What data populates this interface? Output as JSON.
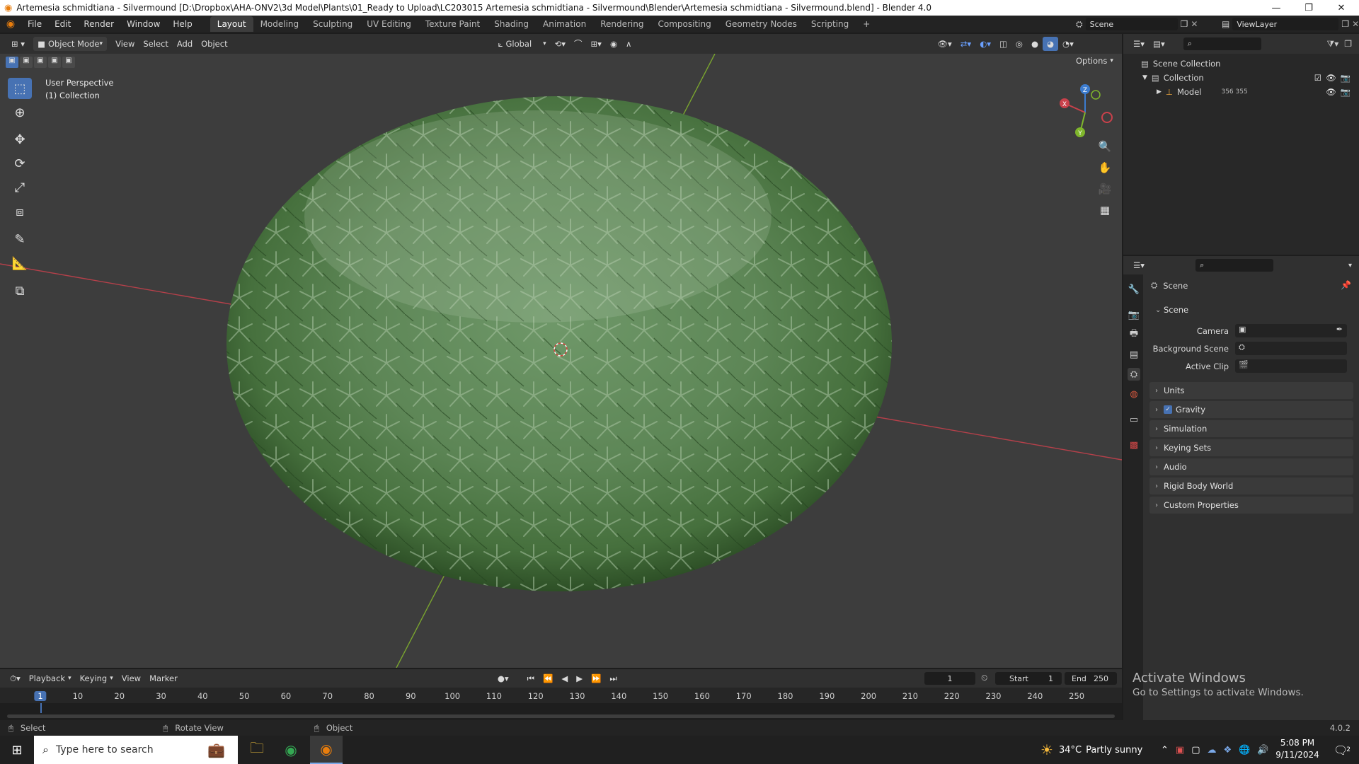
{
  "window": {
    "title": "Artemesia schmidtiana - Silvermound [D:\\Dropbox\\AHA-ONV2\\3d Model\\Plants\\01_Ready to Upload\\LC203015 Artemesia schmidtiana - Silvermound\\Blender\\Artemesia schmidtiana - Silvermound.blend] - Blender 4.0",
    "minimize": "—",
    "restore": "❐",
    "close": "✕"
  },
  "menu": [
    "File",
    "Edit",
    "Render",
    "Window",
    "Help"
  ],
  "workspaces": [
    "Layout",
    "Modeling",
    "Sculpting",
    "UV Editing",
    "Texture Paint",
    "Shading",
    "Animation",
    "Rendering",
    "Compositing",
    "Geometry Nodes",
    "Scripting",
    "+"
  ],
  "scene_field": "Scene",
  "viewlayer_field": "ViewLayer",
  "viewport_header": {
    "mode": "Object Mode",
    "menus": [
      "View",
      "Select",
      "Add",
      "Object"
    ],
    "transform_orientation": "Global",
    "options": "Options"
  },
  "viewport": {
    "perspective": "User Perspective",
    "collection": "(1) Collection",
    "gizmo": {
      "x": "X",
      "y": "Y",
      "z": "Z"
    }
  },
  "outliner": {
    "root": "Scene Collection",
    "collection": "Collection",
    "model": "Model",
    "model_extra": "356 355"
  },
  "properties": {
    "header": "Scene",
    "section": "Scene",
    "camera_label": "Camera",
    "background_label": "Background Scene",
    "clip_label": "Active Clip",
    "panels": [
      "Units",
      "Gravity",
      "Simulation",
      "Keying Sets",
      "Audio",
      "Rigid Body World",
      "Custom Properties"
    ]
  },
  "timeline": {
    "menus": [
      "Playback",
      "Keying",
      "View",
      "Marker"
    ],
    "current_frame": "1",
    "start_label": "Start",
    "start": "1",
    "end_label": "End",
    "end": "250",
    "ticks": [
      "1",
      "10",
      "20",
      "30",
      "40",
      "50",
      "60",
      "70",
      "80",
      "90",
      "100",
      "110",
      "120",
      "130",
      "140",
      "150",
      "160",
      "170",
      "180",
      "190",
      "200",
      "210",
      "220",
      "230",
      "240",
      "250"
    ]
  },
  "statusbar": {
    "select": "Select",
    "rotate": "Rotate View",
    "object": "Object",
    "version": "4.0.2"
  },
  "watermark": {
    "line1": "Activate Windows",
    "line2": "Go to Settings to activate Windows."
  },
  "taskbar": {
    "search_placeholder": "Type here to search",
    "weather_temp": "34°C",
    "weather_desc": "Partly sunny",
    "time": "5:08 PM",
    "date": "9/11/2024",
    "notification_count": "2"
  },
  "colors": {
    "accent": "#4772b3",
    "x_axis": "#c9414b",
    "y_axis": "#7fb62c",
    "z_axis": "#3c7ccf"
  }
}
